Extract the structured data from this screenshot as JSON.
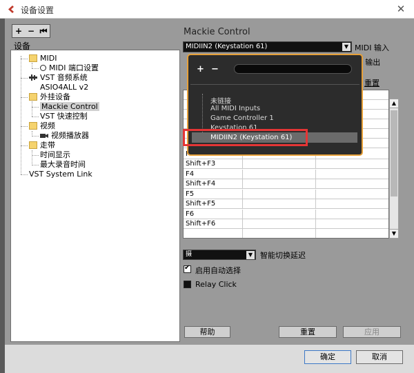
{
  "window": {
    "title": "设备设置",
    "close_glyph": "✕"
  },
  "toolbar": {
    "add": "+",
    "remove": "−",
    "reset": "⏮"
  },
  "tree": {
    "root_label": "设备",
    "items": [
      {
        "label": "MIDI",
        "type": "folder"
      },
      {
        "label": "MIDI 端口设置",
        "type": "radio"
      },
      {
        "label": "VST 音频系统",
        "type": "audio"
      },
      {
        "label": "ASIO4ALL v2",
        "type": "plain"
      },
      {
        "label": "外挂设备",
        "type": "folder"
      },
      {
        "label": "Mackie Control",
        "type": "plain",
        "selected": true
      },
      {
        "label": "VST 快速控制",
        "type": "plain"
      },
      {
        "label": "视频",
        "type": "folder"
      },
      {
        "label": "视频播放器",
        "type": "video"
      },
      {
        "label": "走带",
        "type": "folder"
      },
      {
        "label": "时间显示",
        "type": "plain"
      },
      {
        "label": "最大录音时间",
        "type": "plain"
      },
      {
        "label": "VST System Link",
        "type": "plain"
      }
    ]
  },
  "panel": {
    "title": "Mackie Control",
    "midi_in_value": "MIDIIN2 (Keystation 61)",
    "midi_in_label": "MIDI 输入",
    "midi_out_label": "DI 输出",
    "reset_label": "重置",
    "table_rows": [
      {
        "key": "F3"
      },
      {
        "key": "Shift+F3"
      },
      {
        "key": "F4"
      },
      {
        "key": "Shift+F4"
      },
      {
        "key": "F5"
      },
      {
        "key": "Shift+F5"
      },
      {
        "key": "F6"
      },
      {
        "key": "Shift+F6"
      }
    ],
    "scroll_up": "▲",
    "scroll_down": "▼",
    "smart_select_value": "摄",
    "smart_label": "智能切换延迟",
    "auto_select_label": "启用自动选择",
    "relay_label": "Relay Click",
    "help_button": "帮助",
    "reset_button": "重置",
    "apply_button": "应用"
  },
  "popup": {
    "plus": "+",
    "minus": "−",
    "items": [
      "未链接",
      "All MIDI Inputs",
      "Game Controller 1",
      "Keystation 61",
      "MIDIIN2 (Keystation 61)"
    ],
    "selected_index": 4
  },
  "footer": {
    "ok": "确定",
    "cancel": "取消"
  },
  "colors": {
    "accent": "#e7a038",
    "highlight_box": "#e53535",
    "focus": "#3c78c6"
  }
}
